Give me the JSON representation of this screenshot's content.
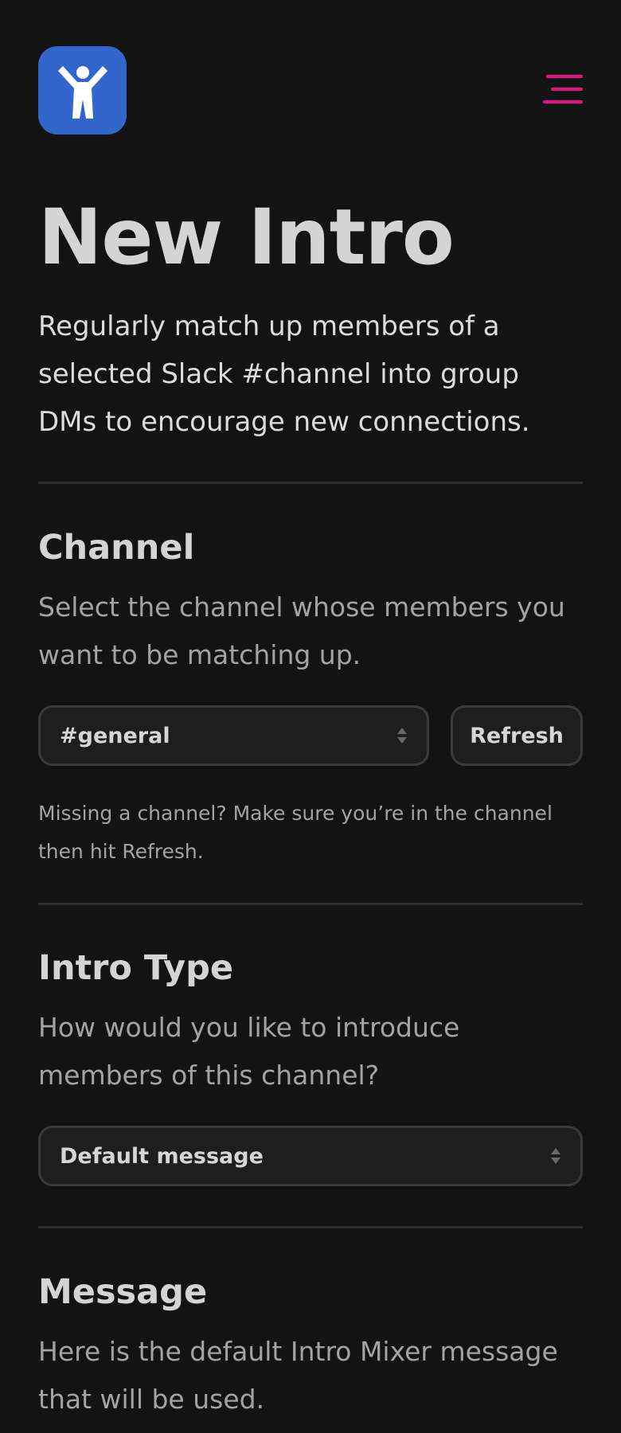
{
  "header": {
    "logo_icon": "person-arms-raised-icon",
    "menu_icon": "hamburger-menu-icon",
    "brand_color": "#3366cc",
    "accent_color": "#e0157f"
  },
  "page": {
    "title": "New Intro",
    "lead": "Regularly match up members of a selected Slack #channel into group DMs to encourage new connections."
  },
  "channel_section": {
    "heading": "Channel",
    "description": "Select the channel whose members you want to be matching up.",
    "selected_channel": "#general",
    "refresh_label": "Refresh",
    "help": "Missing a channel? Make sure you’re in the channel then hit Refresh."
  },
  "intro_type_section": {
    "heading": "Intro Type",
    "description": "How would you like to introduce members of this channel?",
    "selected_type": "Default message"
  },
  "message_section": {
    "heading": "Message",
    "description": "Here is the default Intro Mixer message that will be used."
  }
}
